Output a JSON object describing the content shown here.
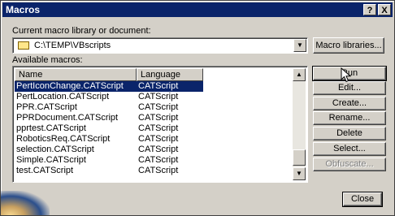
{
  "window": {
    "title": "Macros",
    "help_label": "?",
    "close_label": "X"
  },
  "library": {
    "label": "Current macro library or document:",
    "value": "C:\\TEMP\\VBscripts",
    "button": "Macro libraries..."
  },
  "macros": {
    "label": "Available macros:",
    "columns": [
      "Name",
      "Language"
    ],
    "rows": [
      {
        "name": "PertIconChange.CATScript",
        "language": "CATScript",
        "selected": true
      },
      {
        "name": "PertLocation.CATScript",
        "language": "CATScript"
      },
      {
        "name": "PPR.CATScript",
        "language": "CATScript"
      },
      {
        "name": "PPRDocument.CATScript",
        "language": "CATScript"
      },
      {
        "name": "pprtest.CATScript",
        "language": "CATScript"
      },
      {
        "name": "RoboticsReq.CATScript",
        "language": "CATScript"
      },
      {
        "name": "selection.CATScript",
        "language": "CATScript"
      },
      {
        "name": "Simple.CATScript",
        "language": "CATScript"
      },
      {
        "name": "test.CATScript",
        "language": "CATScript"
      }
    ]
  },
  "actions": {
    "run": "Run",
    "edit": "Edit...",
    "create": "Create...",
    "rename": "Rename...",
    "delete": "Delete",
    "select": "Select...",
    "obfuscate": "Obfuscate..."
  },
  "footer": {
    "close": "Close"
  },
  "icons": {
    "folder": "folder-icon",
    "dropdown": "chevron-down-icon",
    "scroll_up": "scroll-up-icon",
    "scroll_down": "scroll-down-icon",
    "cursor": "mouse-pointer-icon"
  },
  "colors": {
    "titlebar": "#0a246a",
    "selection": "#0a246a",
    "dialog": "#d4d0c8"
  }
}
